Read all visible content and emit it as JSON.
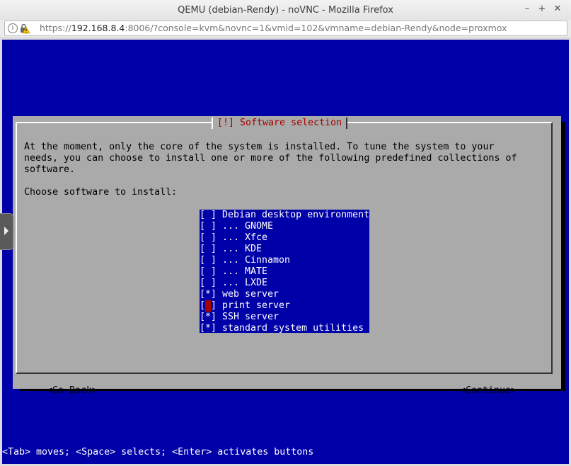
{
  "window": {
    "title": "QEMU (debian-Rendy) - noVNC - Mozilla Firefox",
    "minimize_glyph": "–",
    "maximize_glyph": "+",
    "close_glyph": "✕"
  },
  "urlbar": {
    "scheme": "https://",
    "host": "192.168.8.4",
    "rest": ":8006/?console=kvm&novnc=1&vmid=102&vmname=debian-Rendy&node=proxmox"
  },
  "dialog": {
    "title": "[!] Software selection",
    "body_lines": [
      "At the moment, only the core of the system is installed. To tune the system to your",
      "needs, you can choose to install one or more of the following predefined collections of",
      "software."
    ],
    "prompt": "Choose software to install:",
    "items": [
      {
        "label": "Debian desktop environment",
        "checked": false,
        "mark": " "
      },
      {
        "label": "... GNOME",
        "checked": false,
        "mark": " "
      },
      {
        "label": "... Xfce",
        "checked": false,
        "mark": " "
      },
      {
        "label": "... KDE",
        "checked": false,
        "mark": " "
      },
      {
        "label": "... Cinnamon",
        "checked": false,
        "mark": " "
      },
      {
        "label": "... MATE",
        "checked": false,
        "mark": " "
      },
      {
        "label": "... LXDE",
        "checked": false,
        "mark": " "
      },
      {
        "label": "web server",
        "checked": true,
        "mark": "*"
      },
      {
        "label": "print server",
        "checked": false,
        "mark": " "
      },
      {
        "label": "SSH server",
        "checked": true,
        "mark": "*"
      },
      {
        "label": "standard system utilities",
        "checked": true,
        "mark": "*"
      }
    ],
    "back_button": "<Go Back>",
    "continue_button": "<Continue>"
  },
  "status_line": "<Tab> moves; <Space> selects; <Enter> activates buttons",
  "colors": {
    "console_bg": "#0000a8",
    "dialog_bg": "#aaaaaa",
    "title_fg": "#a80000",
    "cursor": "#a80000"
  }
}
